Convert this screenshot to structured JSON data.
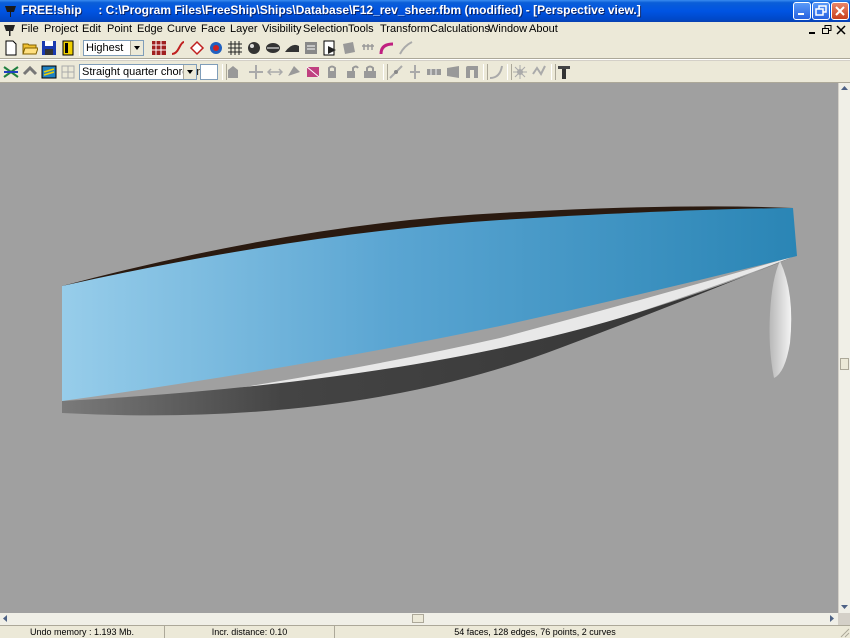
{
  "window": {
    "title": "FREE!ship     : C:\\Program Files\\FreeShip\\Ships\\Database\\F12_rev_sheer.fbm (modified) - [Perspective view.]",
    "accent_color": "#0054e3"
  },
  "menubar": {
    "items": [
      "File",
      "Project",
      "Edit",
      "Point",
      "Edge",
      "Curve",
      "Face",
      "Layer",
      "Visibility",
      "Selection",
      "Tools",
      "Transform",
      "Calculations",
      "Window",
      "About"
    ]
  },
  "toolbar1": {
    "precision_select": {
      "selected": "Highest"
    }
  },
  "toolbar2": {
    "curve_type_select": {
      "selected": "Straight quarter chord line"
    }
  },
  "viewport": {
    "background_color": "#a0a0a0",
    "hull_color": "#2e8fc0",
    "hull_light_color": "#95cbe8"
  },
  "statusbar": {
    "undo_memory": "Undo memory : 1.193 Mb.",
    "incr_distance": "Incr. distance: 0.10",
    "model_stats": "54 faces, 128 edges, 76 points, 2 curves"
  }
}
